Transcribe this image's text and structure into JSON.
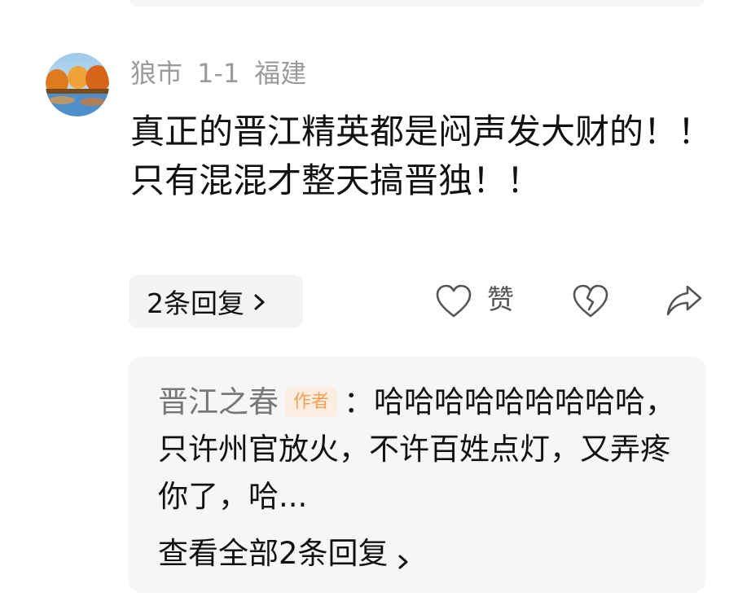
{
  "comment": {
    "username": "狼市",
    "date": "1-1",
    "location": "福建",
    "text": "真正的晋江精英都是闷声发大财的！！只有混混才整天搞晋独！！",
    "replies_label": "2条回复",
    "like_label": "赞"
  },
  "sub_reply": {
    "author": "晋江之春",
    "author_badge": "作者",
    "text": "：哈哈哈哈哈哈哈哈哈，只许州官放火，不许百姓点灯，又弄疼你了，哈...",
    "view_all_label": "查看全部2条回复"
  },
  "colors": {
    "meta_text": "#9b9b9b",
    "badge_bg": "#fbeee0",
    "badge_text": "#f2a15b",
    "card_bg": "#f6f6f6"
  },
  "icons": [
    "heart-outline-icon",
    "broken-heart-icon",
    "share-arrow-icon",
    "chevron-right-icon"
  ]
}
